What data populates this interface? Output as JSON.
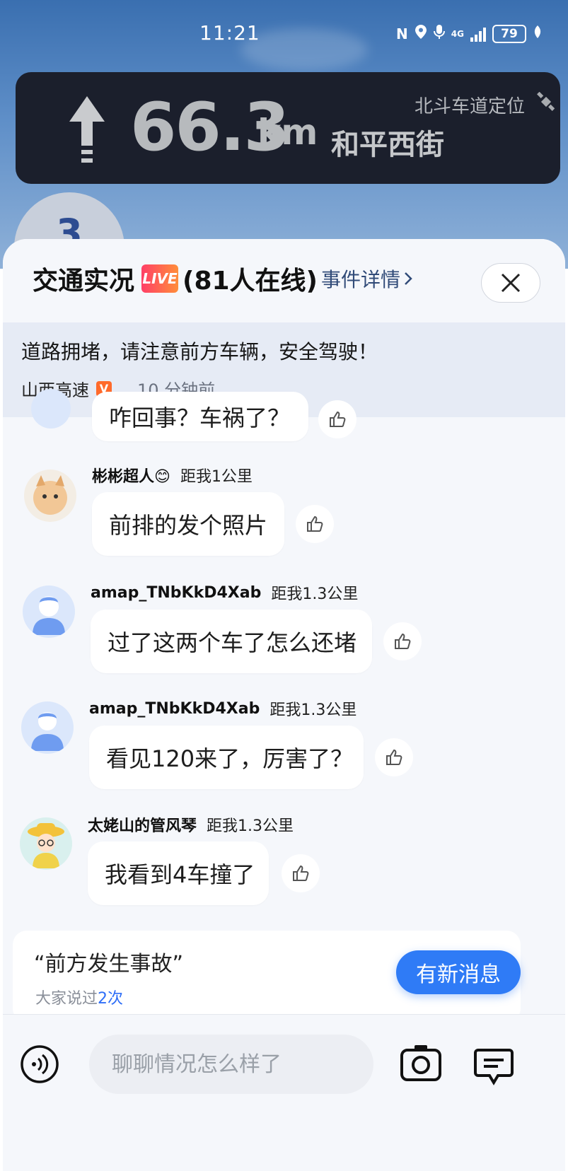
{
  "status_bar": {
    "time": "11:21",
    "network": "4G",
    "battery": "79"
  },
  "navigation": {
    "distance": "66.3",
    "unit": "km",
    "road": "和平西街",
    "lane_positioning": "北斗车道定位"
  },
  "lane_badge": "3",
  "sheet": {
    "title": "交通实况",
    "live_badge": "LIVE",
    "online_count": "(81人在线)",
    "detail_link": "事件详情",
    "notice": {
      "text": "道路拥堵，请注意前方车辆，安全驾驶！",
      "source": "山西高速",
      "source_badge": "V",
      "time": "10 分钟前"
    }
  },
  "messages": [
    {
      "name": "",
      "distance": "",
      "text": "咋回事？车祸了？"
    },
    {
      "name": "彬彬超人😊",
      "distance": "距我1公里",
      "text": "前排的发个照片"
    },
    {
      "name": "amap_TNbKkD4Xab",
      "distance": "距我1.3公里",
      "text": "过了这两个车了怎么还堵"
    },
    {
      "name": "amap_TNbKkD4Xab",
      "distance": "距我1.3公里",
      "text": "看见120来了，厉害了？"
    },
    {
      "name": "太姥山的管风琴",
      "distance": "距我1.3公里",
      "text": "我看到4车撞了"
    }
  ],
  "phrase": {
    "text": "“前方发生事故”",
    "count_prefix": "大家说过",
    "count": "2次"
  },
  "new_message_button": "有新消息",
  "input": {
    "placeholder": "聊聊情况怎么样了"
  },
  "colors": {
    "accent": "#2f7bf6",
    "nav_card": "#1b1f2c",
    "live_badge": "#ff5a55"
  }
}
